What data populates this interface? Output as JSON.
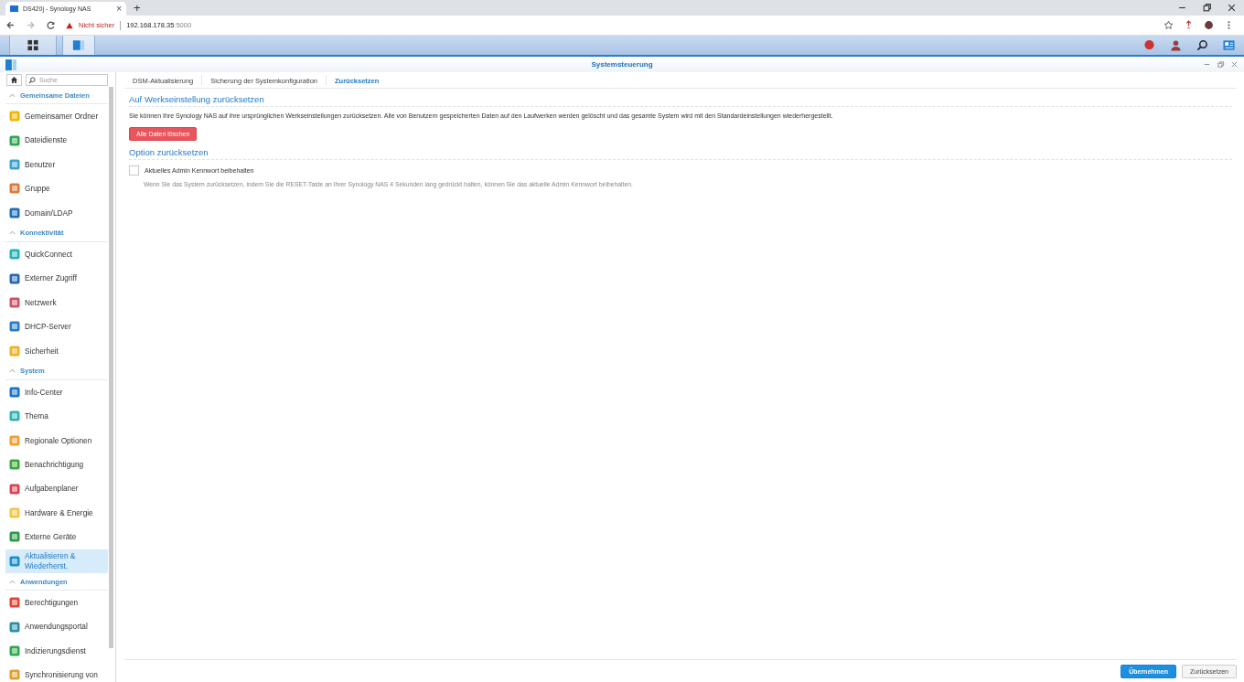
{
  "browser": {
    "tab_title": "DS420j - Synology NAS",
    "tab_close": "×",
    "new_tab": "+",
    "security": "Nicht sicher",
    "host": "192.168.178.35",
    "port": ":5000"
  },
  "window": {
    "title": "Systemsteuerung"
  },
  "sidebar": {
    "search": {
      "placeholder": "Suche"
    },
    "groups": [
      {
        "title": "Gemeinsame Dateien",
        "expanded": true,
        "items": [
          {
            "label": "Gemeinsamer Ordner",
            "selected": false
          },
          {
            "label": "Dateidienste",
            "selected": false
          },
          {
            "label": "Benutzer",
            "selected": false
          },
          {
            "label": "Gruppe",
            "selected": false
          },
          {
            "label": "Domain/LDAP",
            "selected": false
          }
        ]
      },
      {
        "title": "Konnektivität",
        "expanded": true,
        "items": [
          {
            "label": "QuickConnect",
            "selected": false
          },
          {
            "label": "Externer Zugriff",
            "selected": false
          },
          {
            "label": "Netzwerk",
            "selected": false
          },
          {
            "label": "DHCP-Server",
            "selected": false
          },
          {
            "label": "Sicherheit",
            "selected": false
          }
        ]
      },
      {
        "title": "System",
        "expanded": true,
        "items": [
          {
            "label": "Info-Center",
            "selected": false
          },
          {
            "label": "Thema",
            "selected": false
          },
          {
            "label": "Regionale Optionen",
            "selected": false
          },
          {
            "label": "Benachrichtigung",
            "selected": false
          },
          {
            "label": "Aufgabenplaner",
            "selected": false
          },
          {
            "label": "Hardware & Energie",
            "selected": false
          },
          {
            "label": "Externe Geräte",
            "selected": false
          },
          {
            "label": "Aktualisieren & Wiederherst.",
            "selected": true
          }
        ]
      },
      {
        "title": "Anwendungen",
        "expanded": true,
        "items": [
          {
            "label": "Berechtigungen",
            "selected": false
          },
          {
            "label": "Anwendungsportal",
            "selected": false
          },
          {
            "label": "Indizierungsdienst",
            "selected": false
          },
          {
            "label": "Synchronisierung von",
            "selected": false
          }
        ]
      }
    ]
  },
  "tabs": [
    {
      "label": "DSM-Aktualisierung",
      "selected": false
    },
    {
      "label": "Sicherung der Systemkonfiguration",
      "selected": false
    },
    {
      "label": "Zurücksetzen",
      "selected": true
    }
  ],
  "sections": [
    {
      "title": "Auf Werkseinstellung zurücksetzen",
      "text": "Sie können Ihre Synology NAS auf ihre ursprünglichen Werkseinstellungen zurücksetzen. Alle von Benutzern gespeicherten Daten auf den Laufwerken werden gelöscht und das gesamte System wird mit den Standardeinstellungen wiederhergestellt.",
      "button": "Alle Daten löschen"
    },
    {
      "title": "Option zurücksetzen",
      "checkbox": {
        "label": "Aktuelles Admin Kennwort beibehalten",
        "checked": false
      },
      "hint": "Wenn Sie das System zurücksetzen, indem Sie die RESET-Taste an Ihrer Synology NAS 4 Sekunden lang gedrückt halten, können Sie das aktuelle Admin Kennwort beibehalten."
    }
  ],
  "footer": {
    "buttons": [
      {
        "label": "Übernehmen",
        "kind": "primary"
      },
      {
        "label": "Zurücksetzen",
        "kind": "secondary"
      }
    ]
  }
}
